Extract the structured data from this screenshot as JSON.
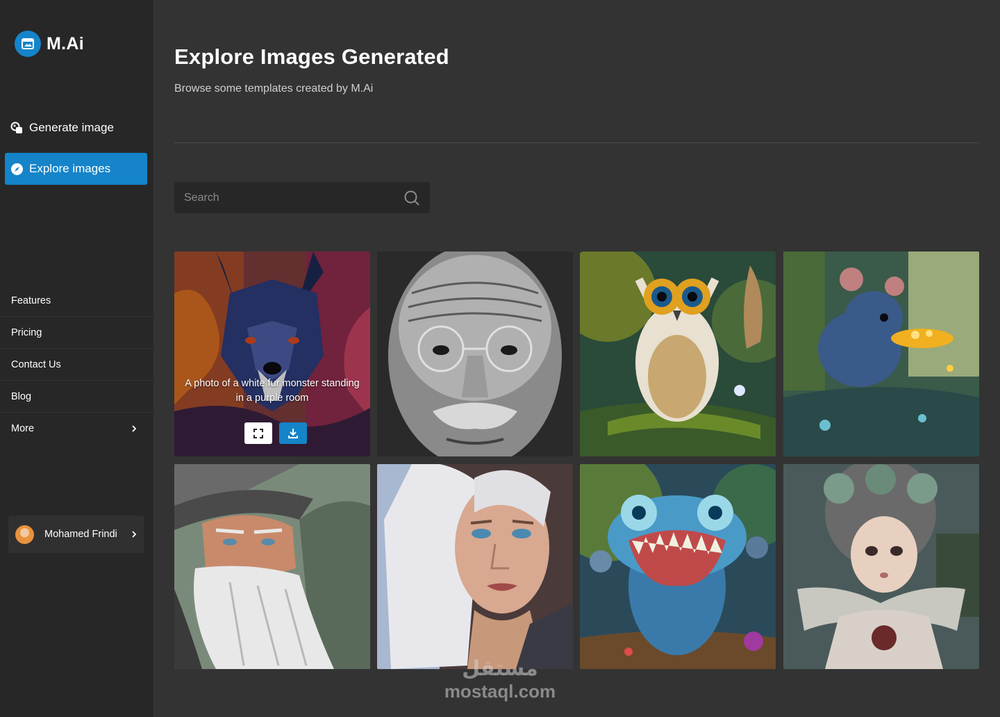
{
  "brand": {
    "name": "M.Ai"
  },
  "nav": {
    "generate_label": "Generate image",
    "explore_label": "Explore images"
  },
  "links": [
    {
      "label": "Features"
    },
    {
      "label": "Pricing"
    },
    {
      "label": "Contact Us"
    },
    {
      "label": "Blog"
    },
    {
      "label": "More"
    }
  ],
  "user": {
    "name": "Mohamed Frindi"
  },
  "header": {
    "title": "Explore Images Generated",
    "subtitle": "Browse some templates created by M.Ai"
  },
  "search": {
    "placeholder": "Search"
  },
  "gallery": {
    "hover_caption": "A photo of a white fur monster standing in a purple room",
    "images": [
      {
        "subject": "wolf"
      },
      {
        "subject": "old man"
      },
      {
        "subject": "owl"
      },
      {
        "subject": "mouse"
      },
      {
        "subject": "wizard"
      },
      {
        "subject": "woman"
      },
      {
        "subject": "monster"
      },
      {
        "subject": "doll girl"
      }
    ]
  },
  "watermark": {
    "arabic": "مستقل",
    "latin": "mostaql.com"
  },
  "colors": {
    "accent": "#1584c9",
    "sidebar": "#272727",
    "background": "#333333"
  }
}
